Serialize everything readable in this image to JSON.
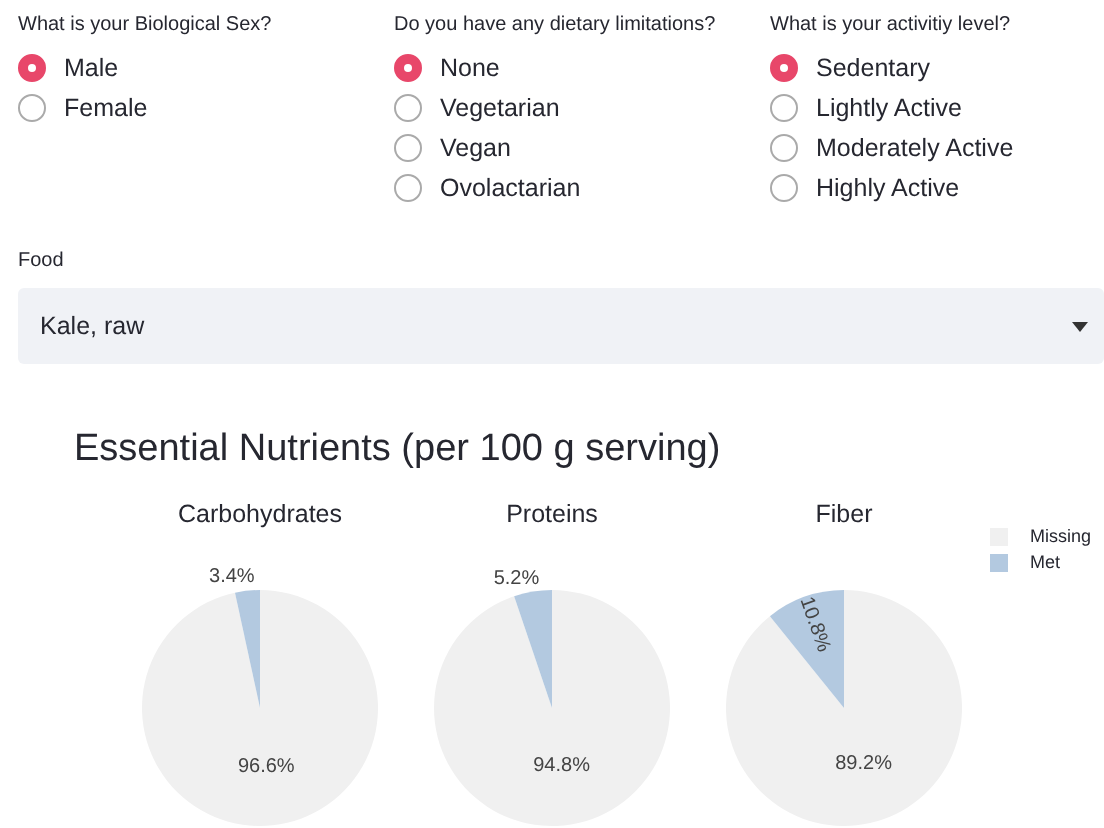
{
  "questions": [
    {
      "label": "What is your Biological Sex?",
      "options": [
        {
          "label": "Male",
          "selected": true
        },
        {
          "label": "Female",
          "selected": false
        }
      ]
    },
    {
      "label": "Do you have any dietary limitations?",
      "options": [
        {
          "label": "None",
          "selected": true
        },
        {
          "label": "Vegetarian",
          "selected": false
        },
        {
          "label": "Vegan",
          "selected": false
        },
        {
          "label": "Ovolactarian",
          "selected": false
        }
      ]
    },
    {
      "label": "What is your activitiy level?",
      "options": [
        {
          "label": "Sedentary",
          "selected": true
        },
        {
          "label": "Lightly Active",
          "selected": false
        },
        {
          "label": "Moderately Active",
          "selected": false
        },
        {
          "label": "Highly Active",
          "selected": false
        }
      ]
    }
  ],
  "food": {
    "label": "Food",
    "value": "Kale, raw"
  },
  "section_title": "Essential Nutrients (per 100 g serving)",
  "charts": [
    {
      "chart_data": {
        "type": "pie",
        "title": "Carbohydrates",
        "values": [
          96.6,
          3.4
        ],
        "value_labels": [
          "96.6%",
          "3.4%"
        ]
      }
    },
    {
      "chart_data": {
        "type": "pie",
        "title": "Proteins",
        "values": [
          94.8,
          5.2
        ],
        "value_labels": [
          "94.8%",
          "5.2%"
        ]
      }
    },
    {
      "chart_data": {
        "type": "pie",
        "title": "Fiber",
        "values": [
          89.2,
          10.8
        ],
        "value_labels": [
          "89.2%",
          "10.8%"
        ]
      }
    }
  ],
  "legend": [
    {
      "label": "Missing",
      "color": "#f0f0f0"
    },
    {
      "label": "Met",
      "color": "#b3c9e0"
    }
  ]
}
